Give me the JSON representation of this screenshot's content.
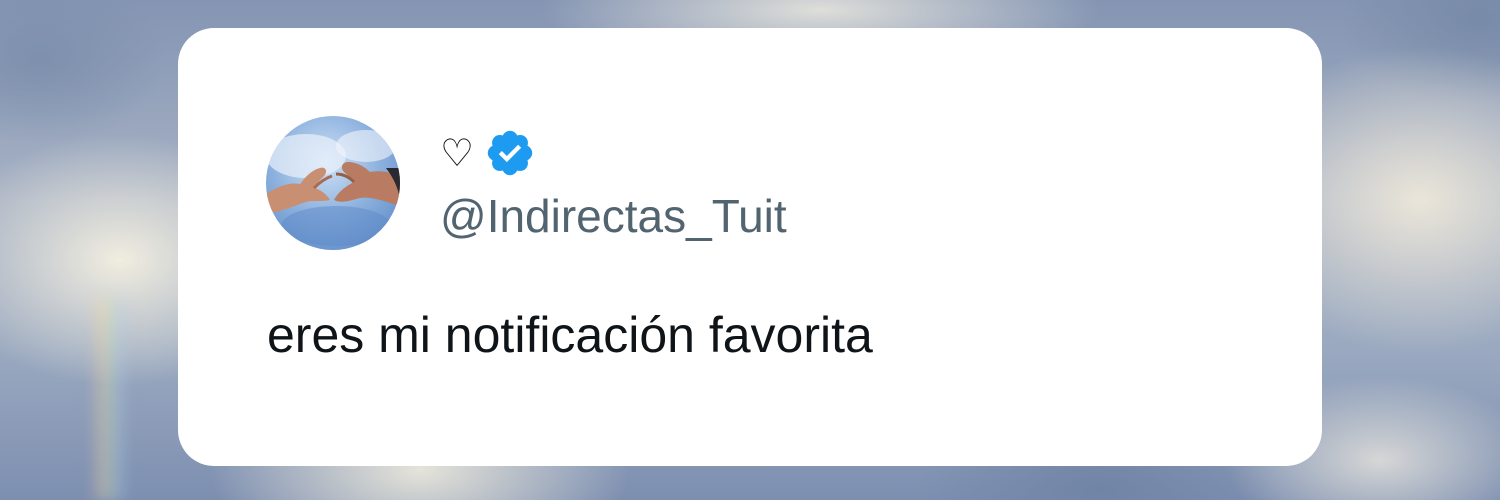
{
  "background": {
    "description_icon": "cloudy-sky-background"
  },
  "tweet": {
    "avatar_icon": "heart-hands-sky-avatar",
    "display_name": "♡",
    "verified_icon": "verified-badge-icon",
    "verified_color": "#1d9bf0",
    "handle": "@Indirectas_Tuit",
    "text": "eres mi notificación favorita"
  },
  "colors": {
    "card": "#ffffff",
    "text": "#0f1419",
    "handle": "#536471"
  }
}
